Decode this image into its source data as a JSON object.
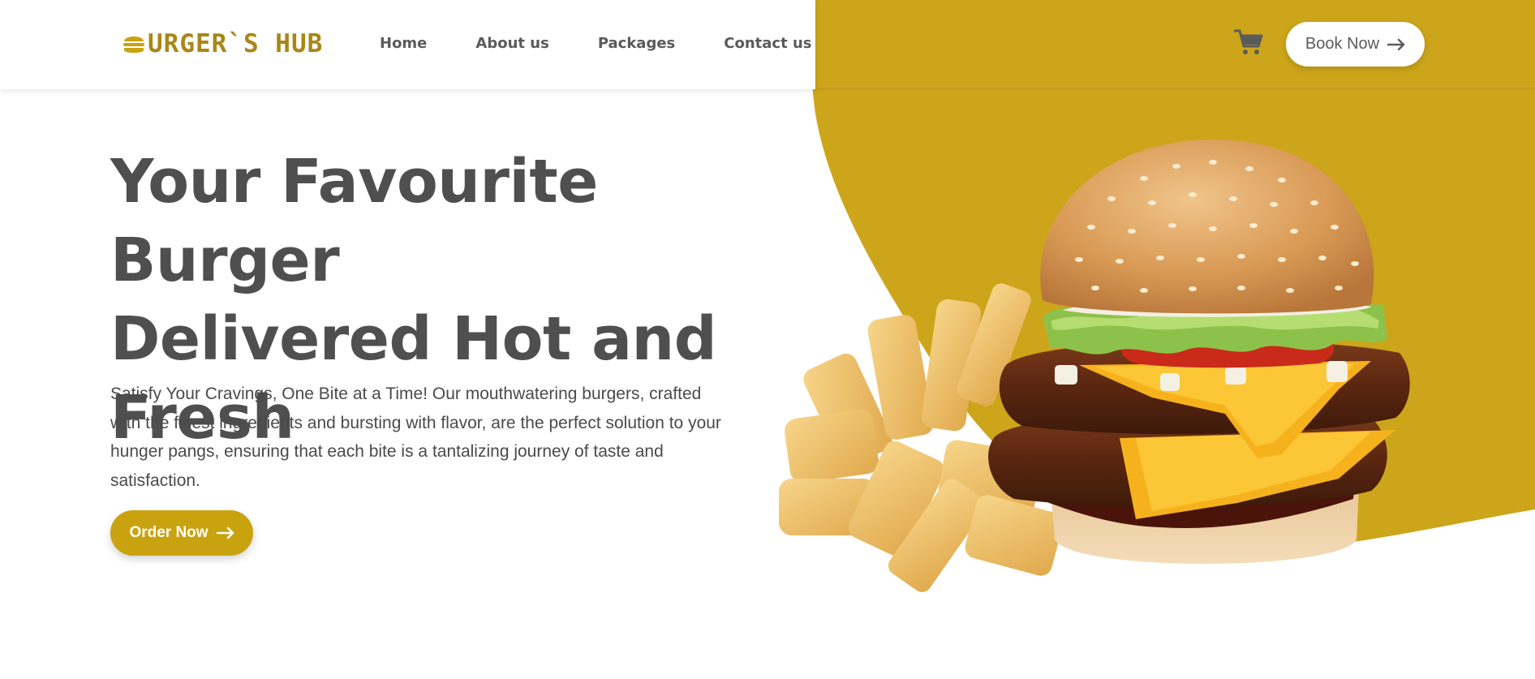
{
  "brand": {
    "logo_text": "URGER`S HUB",
    "logo_icon": "burger-icon",
    "accent_color": "#c9a30f",
    "logo_color": "#a98618"
  },
  "nav": {
    "items": [
      {
        "label": "Home"
      },
      {
        "label": "About us"
      },
      {
        "label": "Packages"
      },
      {
        "label": "Contact us"
      }
    ]
  },
  "header": {
    "cart_icon": "cart-icon",
    "book_label": "Book Now",
    "arrow_icon": "arrow-right-icon"
  },
  "hero": {
    "title_lines": [
      "Your Favourite Burger",
      "Delivered Hot and",
      "Fresh"
    ],
    "description_lines": [
      "Satisfy Your Cravings, One Bite at a Time! Our mouthwatering burgers, crafted",
      "with the finest ingredients and bursting with flavor, are the perfect solution to your",
      "hunger pangs, ensuring that each bite is a tantalizing journey of taste and",
      "satisfaction."
    ],
    "order_label": "Order Now",
    "image_name": "burger-and-fries-image"
  },
  "colors": {
    "background": "#ffffff",
    "mustard": "#cca51a",
    "heading": "#4f4f4f",
    "nav_text": "#5a5a5a"
  }
}
